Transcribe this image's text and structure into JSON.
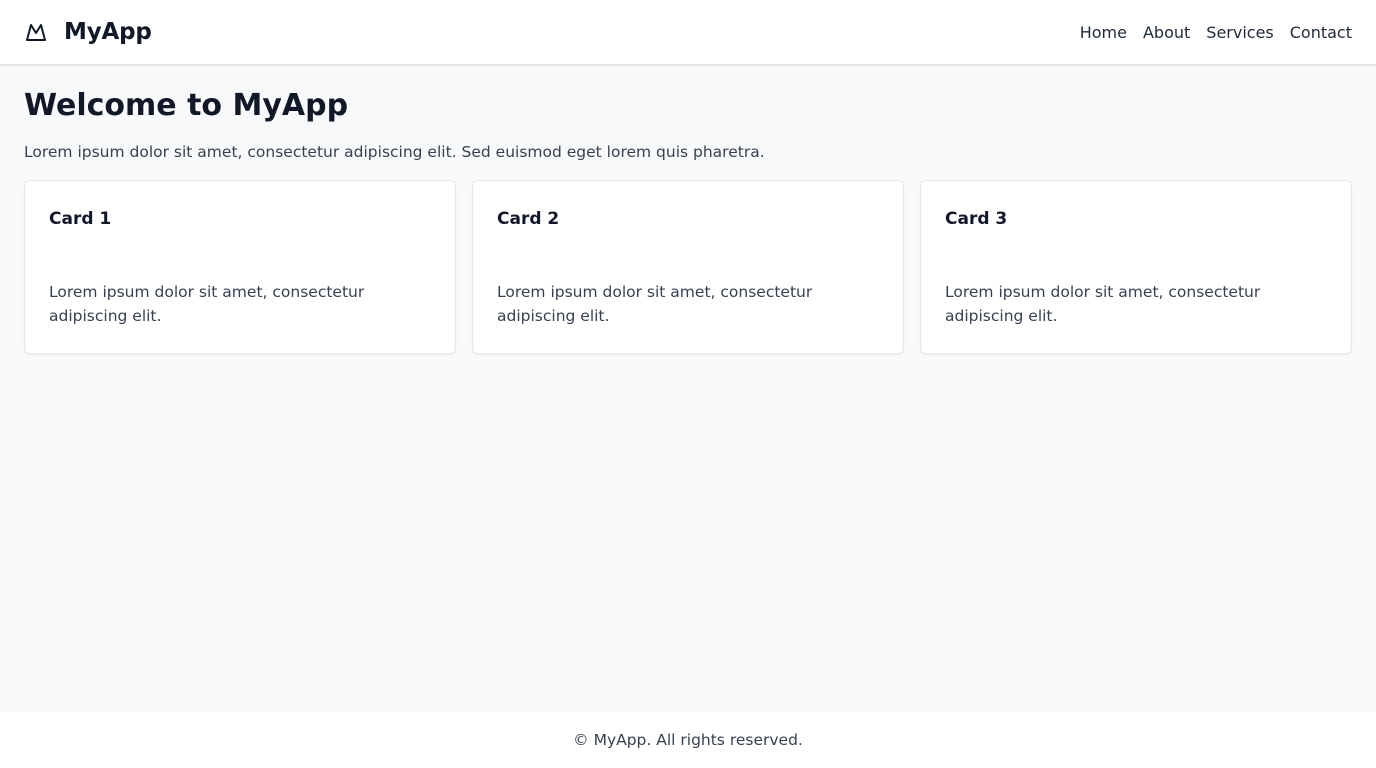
{
  "header": {
    "logo_icon": "mountain-icon",
    "brand_name": "MyApp",
    "nav": [
      {
        "label": "Home"
      },
      {
        "label": "About"
      },
      {
        "label": "Services"
      },
      {
        "label": "Contact"
      }
    ]
  },
  "main": {
    "title": "Welcome to MyApp",
    "intro": "Lorem ipsum dolor sit amet, consectetur adipiscing elit. Sed euismod eget lorem quis pharetra.",
    "cards": [
      {
        "title": "Card 1",
        "body": "Lorem ipsum dolor sit amet, consectetur adipiscing elit."
      },
      {
        "title": "Card 2",
        "body": "Lorem ipsum dolor sit amet, consectetur adipiscing elit."
      },
      {
        "title": "Card 3",
        "body": "Lorem ipsum dolor sit amet, consectetur adipiscing elit."
      }
    ]
  },
  "footer": {
    "text": "© MyApp. All rights reserved."
  },
  "colors": {
    "background": "#f8f9fb",
    "surface": "#ffffff",
    "text_primary": "#111827",
    "text_secondary": "#374151",
    "border": "#e5e7eb"
  }
}
